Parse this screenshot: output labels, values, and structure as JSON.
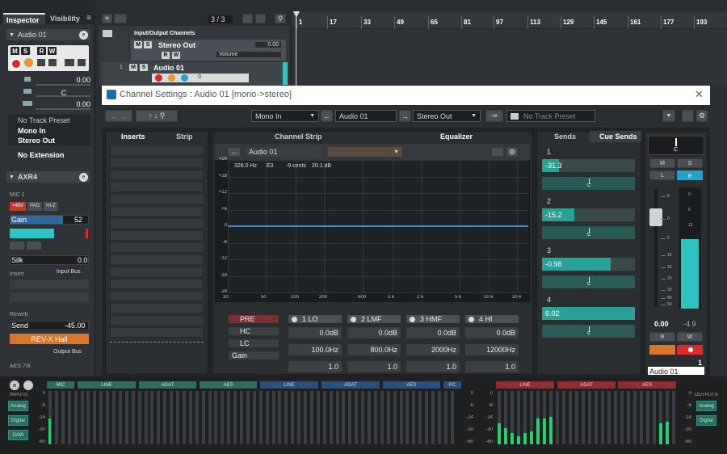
{
  "inspector": {
    "tab_inspector": "Inspector",
    "tab_visibility": "Visibility",
    "track_name": "Audio 01",
    "msrw": [
      "M",
      "S",
      "R",
      "W"
    ],
    "volume_value": "0.00",
    "pan_value": "C",
    "delay_value": "0.00",
    "no_track_preset": "No Track Preset",
    "mono_in": "Mono In",
    "stereo_out": "Stereo Out",
    "no_extension": "No Extension",
    "axr4": "AXR4",
    "mic1": "MIC 1",
    "badges": [
      "+48V",
      "PAD",
      "HI-Z"
    ],
    "gain_label": "Gain",
    "gain_value": "52",
    "silk_label": "Silk",
    "silk_value": "0.0",
    "insert_label": "Insert",
    "input_bus": "Input Bus",
    "reverb": "Reverb",
    "send_label": "Send",
    "send_value": "-45.00",
    "rev_hall": "REV-X Hall",
    "output_bus": "Output Bus",
    "aes78": "AES 7/8"
  },
  "project": {
    "counter": "3 / 3",
    "folder_name": "Input/Output Channels",
    "stereo_out": "Stereo Out",
    "stereo_out_value": "0.00",
    "volume_label": "Volume",
    "track_number": "1",
    "track_name": "Audio 01",
    "zero_label": "0",
    "ruler": [
      "1",
      "17",
      "33",
      "49",
      "65",
      "81",
      "97",
      "113",
      "129",
      "145",
      "161",
      "177",
      "193"
    ]
  },
  "channel_settings": {
    "title": "Channel Settings : Audio 01 [mono->stereo]",
    "input": "Mono In",
    "channel": "Audio 01",
    "output": "Stereo Out",
    "preset": "No Track Preset",
    "tab_inserts": "Inserts",
    "tab_strip": "Strip",
    "tab_channel_strip": "Channel Strip",
    "tab_equalizer": "Equalizer",
    "tab_sends": "Sends",
    "tab_cue_sends": "Cue Sends",
    "eq_channel": "Audio 01",
    "eq_readout": {
      "freq": "328.0 Hz",
      "note": "E3",
      "cents": "-9 cents",
      "db": "20.1 dB"
    },
    "y_ticks": [
      "+24",
      "+18",
      "+12",
      "+6",
      "0",
      "-6",
      "-12",
      "-18",
      "-24"
    ],
    "x_ticks": [
      "20",
      "50",
      "100",
      "200",
      "500",
      "1 k",
      "2 k",
      "5 k",
      "10 k",
      "20 k"
    ],
    "pre_label": "PRE",
    "hc_label": "HC",
    "lc_label": "LC",
    "gain_label": "Gain",
    "bands": [
      {
        "name": "1 LO",
        "gain": "0.0dB",
        "freq": "100.0Hz",
        "q": "1.0"
      },
      {
        "name": "2 LMF",
        "gain": "0.0dB",
        "freq": "800.0Hz",
        "q": "1.0"
      },
      {
        "name": "3 HMF",
        "gain": "0.0dB",
        "freq": "2000Hz",
        "q": "1.0"
      },
      {
        "name": "4 HI",
        "gain": "0.0dB",
        "freq": "12000Hz",
        "q": "1.0"
      }
    ],
    "sends": [
      {
        "num": "1",
        "value": "-31.3",
        "level": 0.18,
        "pan": "C"
      },
      {
        "num": "2",
        "value": "-15.2",
        "level": 0.35,
        "pan": "C"
      },
      {
        "num": "3",
        "value": "-0.98",
        "level": 0.74,
        "pan": "C"
      },
      {
        "num": "4",
        "value": "6.02",
        "level": 1.0,
        "pan": "C"
      }
    ],
    "fader": {
      "pan": "C",
      "m": "M",
      "s": "S",
      "l": "L",
      "scale": [
        "6",
        "0",
        "5",
        "10",
        "15",
        "20",
        "30",
        "40",
        "50"
      ],
      "meter_scale": [
        "0",
        "6",
        "12"
      ],
      "value": "0.00",
      "peak": "-4.9",
      "r": "R",
      "w": "W",
      "channel_number": "1",
      "channel_name": "Audio 01"
    }
  },
  "meter_bridge": {
    "inputs_label": "INPUTS",
    "outputs_label": "OUTPUTS",
    "in_groups": [
      {
        "label": "MIC",
        "color": "#2f6b5f"
      },
      {
        "label": "LINE",
        "color": "#2f6b5f"
      },
      {
        "label": "ADAT",
        "color": "#2f6b5f"
      },
      {
        "label": "AES",
        "color": "#2f6b5f"
      },
      {
        "label": "LINE",
        "color": "#2d4f7a"
      },
      {
        "label": "ADAT",
        "color": "#2d4f7a"
      },
      {
        "label": "AES",
        "color": "#2d4f7a"
      },
      {
        "label": "PC",
        "color": "#2d4f7a"
      }
    ],
    "out_groups": [
      {
        "label": "LINE",
        "color": "#8a2f33"
      },
      {
        "label": "ADAT",
        "color": "#8a2f33"
      },
      {
        "label": "AES",
        "color": "#8a2f33"
      }
    ],
    "scale": [
      "0",
      "-6",
      "-14",
      "-30",
      "-60"
    ],
    "left_buttons": [
      "Analog",
      "Digital",
      "DAW"
    ],
    "right_buttons": [
      "Analog",
      "Digital"
    ]
  }
}
